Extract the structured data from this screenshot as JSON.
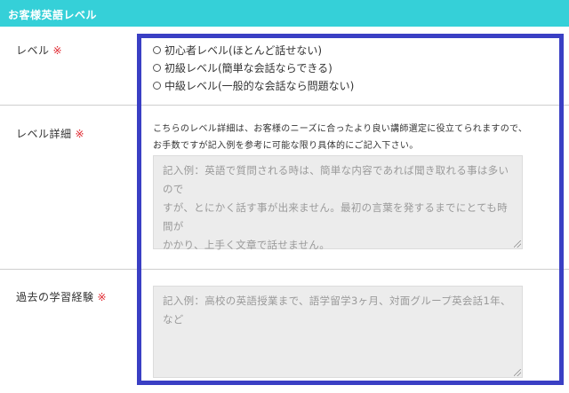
{
  "section": {
    "title": "お客様英語レベル"
  },
  "required_mark": "※",
  "level": {
    "label": "レベル",
    "options": [
      "初心者レベル(ほとんど話せない)",
      "初級レベル(簡単な会話ならできる)",
      "中級レベル(一般的な会話なら問題ない)"
    ]
  },
  "level_detail": {
    "label": "レベル詳細",
    "description_1": "こちらのレベル詳細は、お客様のニーズに合ったより良い講師選定に役立てられますので、",
    "description_2": "お手数ですが記入例を参考に可能な限り具体的にご記入下さい。",
    "placeholder_1": "記入例：英語で質問される時は、簡単な内容であれば聞き取れる事は多いので",
    "placeholder_2": "すが、とにかく話す事が出来ません。最初の言葉を発するまでにとても時間が",
    "placeholder_3": "かかり、上手く文章で話せません。"
  },
  "experience": {
    "label": "過去の学習経験",
    "placeholder": "記入例：高校の英語授業まで、語学留学3ヶ月、対面グループ英会話1年、など"
  },
  "colors": {
    "header_bg": "#35d0d8",
    "highlight": "#3a3fc4",
    "required": "#e0262e",
    "textarea_bg": "#ececec"
  }
}
